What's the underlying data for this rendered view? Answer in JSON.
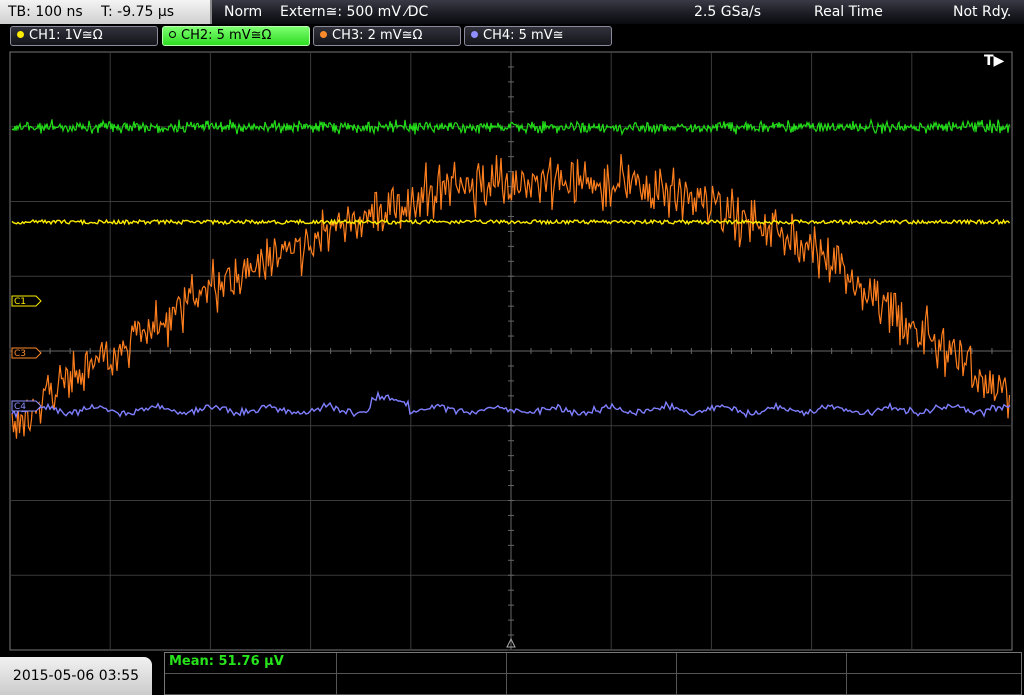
{
  "status_bar": {
    "timebase": "TB: 100 ns",
    "trigger_time": "T: -9.75 µs",
    "mode": "Norm",
    "trigger_source": "Extern≅: 500 mV ⁄DC",
    "sample_rate": "2.5 GSa/s",
    "acq_mode": "Real Time",
    "trigger_status": "Not Rdy."
  },
  "channels": [
    {
      "id": "ch1",
      "label": "CH1: 1V≅Ω",
      "color": "#ffee00",
      "active": false
    },
    {
      "id": "ch2",
      "label": "CH2: 5 mV≅Ω",
      "color": "#23e01a",
      "active": true
    },
    {
      "id": "ch3",
      "label": "CH3: 2 mV≅Ω",
      "color": "#ff8a2a",
      "active": false
    },
    {
      "id": "ch4",
      "label": "CH4: 5 mV≅",
      "color": "#8f8fff",
      "active": false
    }
  ],
  "markers": {
    "c1": "C1",
    "c3": "C3",
    "c4": "C4"
  },
  "trigger_marker": "T▶",
  "measurement": {
    "label": "Mean: 51.76 µV"
  },
  "datetime": "2015-05-06 03:55",
  "colors": {
    "grid": "#3a3a3a",
    "grid_center": "#666666",
    "background": "#000000"
  }
}
